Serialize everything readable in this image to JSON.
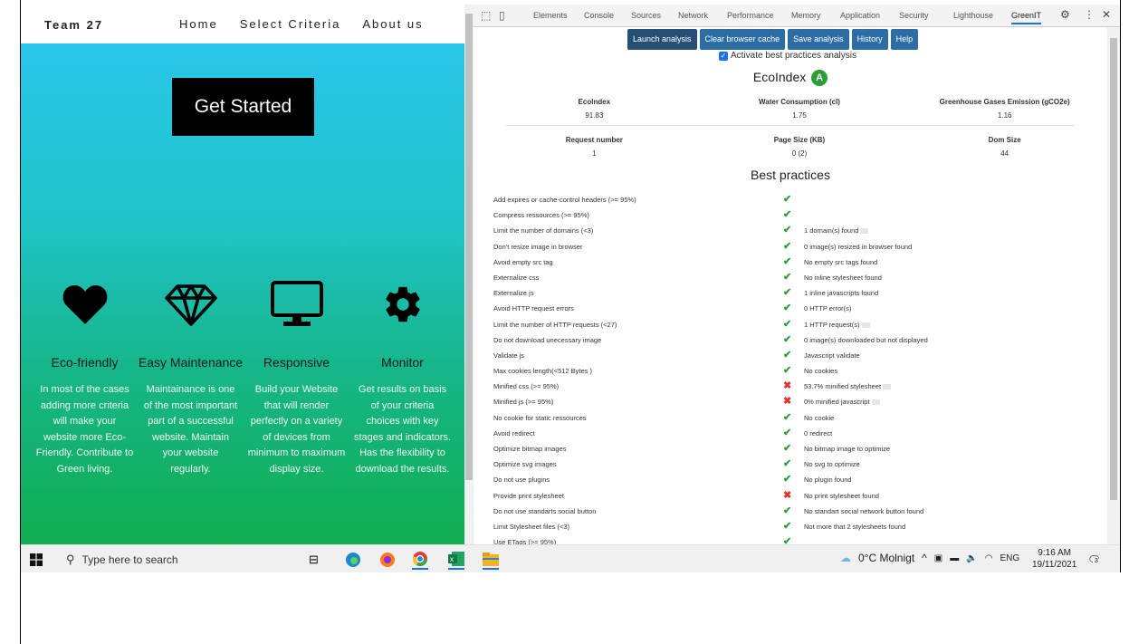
{
  "site": {
    "brand": "Team 27",
    "nav": [
      "Home",
      "Select Criteria",
      "About us"
    ],
    "cta": "Get Started",
    "features": [
      {
        "icon": "heart-icon",
        "title": "Eco-friendly",
        "text": "In most of the cases adding more criteria will make your website more Eco-Friendly. Contribute to Green living."
      },
      {
        "icon": "diamond-icon",
        "title": "Easy Maintenance",
        "text": "Maintainance is one of the most important part of a successful website. Maintain your website regularly."
      },
      {
        "icon": "monitor-icon",
        "title": "Responsive",
        "text": "Build your Website that will render perfectly on a variety of devices from minimum to maximum display size."
      },
      {
        "icon": "gear-icon",
        "title": "Monitor",
        "text": "Get results on basis of your criteria choices with key stages and indicators. Has the flexibility to download the results."
      }
    ],
    "colors": {
      "gradient_top": "#2ac6ea",
      "gradient_bottom": "#0fae4f"
    }
  },
  "devtools": {
    "tabs": [
      "Elements",
      "Console",
      "Sources",
      "Network",
      "Performance",
      "Memory",
      "Application",
      "Security",
      "Lighthouse",
      "GreenIT"
    ],
    "active_tab": "GreenIT",
    "buttons": [
      "Launch analysis",
      "Clear browser cache",
      "Save analysis",
      "History",
      "Help"
    ],
    "best_practices_toggle": "Activate best practices analysis",
    "ecoindex_title": "EcoIndex",
    "grade": "A",
    "metrics_row1": [
      {
        "label": "EcoIndex",
        "value": "91.83"
      },
      {
        "label": "Water Consumption (cl)",
        "value": "1.75"
      },
      {
        "label": "Greenhouse Gases Emission (gCO2e)",
        "value": "1.16"
      }
    ],
    "metrics_row2": [
      {
        "label": "Request number",
        "value": "1"
      },
      {
        "label": "Page Size (KB)",
        "value": "0 (2)"
      },
      {
        "label": "Dom Size",
        "value": "44"
      }
    ],
    "best_practices_title": "Best practices",
    "rules": [
      {
        "name": "Add expires or cache-control headers (>= 95%)",
        "status": "ok",
        "comment": "",
        "more": false
      },
      {
        "name": "Compress ressources (>= 95%)",
        "status": "ok",
        "comment": "",
        "more": false
      },
      {
        "name": "Limit the number of domains (<3)",
        "status": "ok",
        "comment": "1 domain(s) found",
        "more": true
      },
      {
        "name": "Don't resize image in browser",
        "status": "ok",
        "comment": "0 image(s) resized in browser found",
        "more": false
      },
      {
        "name": "Avoid empty src tag",
        "status": "ok",
        "comment": "No empty src tags found",
        "more": false
      },
      {
        "name": "Externalize css",
        "status": "ok",
        "comment": "No inline stylesheet found",
        "more": false
      },
      {
        "name": "Externalize js",
        "status": "ok",
        "comment": "1 inline javascripts found",
        "more": false
      },
      {
        "name": "Avoid HTTP request errors",
        "status": "ok",
        "comment": "0 HTTP error(s)",
        "more": false
      },
      {
        "name": "Limit the number of HTTP requests (<27)",
        "status": "ok",
        "comment": "1 HTTP request(s)",
        "more": true
      },
      {
        "name": "Do not download unecessary image",
        "status": "ok",
        "comment": "0 image(s) downloaded but not displayed",
        "more": false
      },
      {
        "name": "Validate js",
        "status": "ok",
        "comment": "Javascript validate",
        "more": false
      },
      {
        "name": "Max cookies length(<512 Bytes )",
        "status": "ok",
        "comment": "No cookies",
        "more": false
      },
      {
        "name": "Minified css (>= 95%)",
        "status": "bad",
        "comment": "53.7% minified stylesheet",
        "more": true
      },
      {
        "name": "Minified js (>= 95%)",
        "status": "bad",
        "comment": "0% minified javascript",
        "more": true
      },
      {
        "name": "No cookie for static ressources",
        "status": "ok",
        "comment": "No cookie",
        "more": false
      },
      {
        "name": "Avoid redirect",
        "status": "ok",
        "comment": "0 redirect",
        "more": false
      },
      {
        "name": "Optimize bitmap images",
        "status": "ok",
        "comment": "No bitmap image to optimize",
        "more": false
      },
      {
        "name": "Optimize svg images",
        "status": "ok",
        "comment": "No svg to optimize",
        "more": false
      },
      {
        "name": "Do not use plugins",
        "status": "ok",
        "comment": "No plugin found",
        "more": false
      },
      {
        "name": "Provide print stylesheet",
        "status": "bad",
        "comment": "No print stylesheet found",
        "more": false
      },
      {
        "name": "Do not use standarts social button",
        "status": "ok",
        "comment": "No standart social network button found",
        "more": false
      },
      {
        "name": "Limit Stylesheet files (<3)",
        "status": "ok",
        "comment": "Not more that 2 stylesheets found",
        "more": false
      },
      {
        "name": "Use ETags (>= 95%)",
        "status": "ok",
        "comment": "",
        "more": false
      }
    ]
  },
  "taskbar": {
    "search_placeholder": "Type here to search",
    "weather": "0°C Molnigt",
    "lang": "ENG",
    "time": "9:16 AM",
    "date": "19/11/2021",
    "notifications": "3"
  }
}
